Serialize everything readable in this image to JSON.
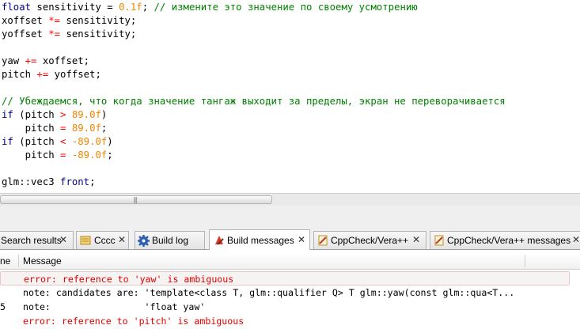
{
  "editor": {
    "lines": [
      [
        {
          "t": "float",
          "c": "kw"
        },
        {
          "t": " sensitivity = ",
          "c": ""
        },
        {
          "t": "0.1f",
          "c": "num"
        },
        {
          "t": "; ",
          "c": ""
        },
        {
          "t": "// измените это значение по своему усмотрению",
          "c": "cm"
        }
      ],
      [
        {
          "t": "xoffset ",
          "c": ""
        },
        {
          "t": "*=",
          "c": "op"
        },
        {
          "t": " sensitivity;",
          "c": ""
        }
      ],
      [
        {
          "t": "yoffset ",
          "c": ""
        },
        {
          "t": "*=",
          "c": "op"
        },
        {
          "t": " sensitivity;",
          "c": ""
        }
      ],
      [],
      [
        {
          "t": "yaw ",
          "c": ""
        },
        {
          "t": "+=",
          "c": "op"
        },
        {
          "t": " xoffset;",
          "c": ""
        }
      ],
      [
        {
          "t": "pitch ",
          "c": ""
        },
        {
          "t": "+=",
          "c": "op"
        },
        {
          "t": " yoffset;",
          "c": ""
        }
      ],
      [],
      [
        {
          "t": "// Убеждаемся, что когда значение тангаж выходит за пределы, экран не переворачивается",
          "c": "cm"
        }
      ],
      [
        {
          "t": "if",
          "c": "kw"
        },
        {
          "t": " (pitch ",
          "c": ""
        },
        {
          "t": ">",
          "c": "op"
        },
        {
          "t": " ",
          "c": ""
        },
        {
          "t": "89.0f",
          "c": "num"
        },
        {
          "t": ")",
          "c": ""
        }
      ],
      [
        {
          "t": "    pitch ",
          "c": ""
        },
        {
          "t": "=",
          "c": "op"
        },
        {
          "t": " ",
          "c": ""
        },
        {
          "t": "89.0f",
          "c": "num"
        },
        {
          "t": ";",
          "c": ""
        }
      ],
      [
        {
          "t": "if",
          "c": "kw"
        },
        {
          "t": " (pitch ",
          "c": ""
        },
        {
          "t": "<",
          "c": "op"
        },
        {
          "t": " ",
          "c": ""
        },
        {
          "t": "-89.0f",
          "c": "num"
        },
        {
          "t": ")",
          "c": ""
        }
      ],
      [
        {
          "t": "    pitch ",
          "c": ""
        },
        {
          "t": "=",
          "c": "op"
        },
        {
          "t": " ",
          "c": ""
        },
        {
          "t": "-89.0f",
          "c": "num"
        },
        {
          "t": ";",
          "c": ""
        }
      ],
      [],
      [
        {
          "t": "glm::vec3 ",
          "c": ""
        },
        {
          "t": "front",
          "c": "kw"
        },
        {
          "t": ";",
          "c": ""
        }
      ]
    ]
  },
  "tabs": [
    {
      "label": "Search results",
      "icon": "search-results-icon",
      "active": false
    },
    {
      "label": "Cccc",
      "icon": "cccc-icon",
      "active": false
    },
    {
      "label": "Build log",
      "icon": "gear-icon",
      "active": false
    },
    {
      "label": "Build messages",
      "icon": "build-messages-icon",
      "active": true
    },
    {
      "label": "CppCheck/Vera++",
      "icon": "cppcheck-icon",
      "active": false
    },
    {
      "label": "CppCheck/Vera++ messages",
      "icon": "cppcheck-messages-icon",
      "active": false
    }
  ],
  "tab_close": "✕",
  "list": {
    "columns": {
      "line": "ne",
      "message": "Message"
    },
    "rows": [
      {
        "line": "",
        "message": "error: reference to 'yaw' is ambiguous",
        "kind": "error",
        "selected": true
      },
      {
        "line": "",
        "message": "note: candidates are: 'template<class T, glm::qualifier Q> T glm::yaw(const glm::qua<T...",
        "kind": "note",
        "selected": false
      },
      {
        "line": "5",
        "message": "note:                 'float yaw'",
        "kind": "note",
        "selected": false
      },
      {
        "line": "",
        "message": "error: reference to 'pitch' is ambiguous",
        "kind": "error",
        "selected": false
      }
    ]
  },
  "colors": {
    "keyword": "#00008b",
    "number": "#f28500",
    "operator": "#ff0000",
    "comment": "#008000",
    "error": "#e00000"
  }
}
